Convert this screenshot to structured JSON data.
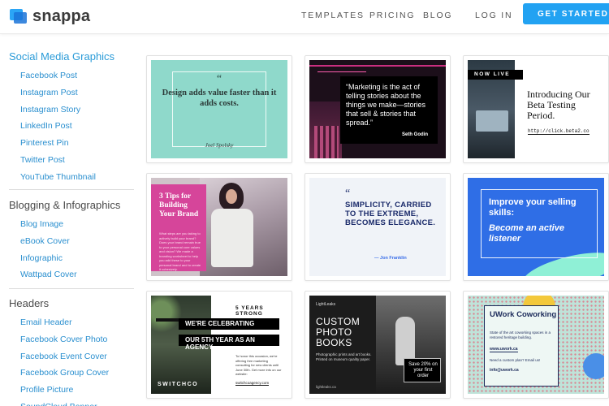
{
  "header": {
    "logo_text": "snappa",
    "nav": [
      "TEMPLATES",
      "PRICING",
      "BLOG"
    ],
    "login": "LOG IN",
    "cta": "GET STARTED FREE"
  },
  "sidebar": {
    "sections": [
      {
        "title": "Social Media Graphics",
        "items": [
          "Facebook Post",
          "Instagram Post",
          "Instagram Story",
          "LinkedIn Post",
          "Pinterest Pin",
          "Twitter Post",
          "YouTube Thumbnail"
        ]
      },
      {
        "title": "Blogging & Infographics",
        "items": [
          "Blog Image",
          "eBook Cover",
          "Infographic",
          "Wattpad Cover"
        ]
      },
      {
        "title": "Headers",
        "items": [
          "Email Header",
          "Facebook Cover Photo",
          "Facebook Event Cover",
          "Facebook Group Cover",
          "Profile Picture",
          "SoundCloud Banner"
        ]
      }
    ]
  },
  "templates": [
    {
      "quote_mark": "“",
      "text": "Design adds value faster than it adds costs.",
      "author": "Joel Spolsky"
    },
    {
      "text": "“Marketing is the act of telling stories about the things we make—stories that sell & stories that spread.”",
      "author": "Seth Godin"
    },
    {
      "badge": "NOW LIVE",
      "text": "Introducing Our Beta Testing Period.",
      "link": "http://click.beta2.co"
    },
    {
      "heading": "3 Tips for Building Your Brand",
      "body": "What steps are you taking to actively build your brand? Does your brand remain true to your personal core values and vision? We made a branding worksheet to help you add these to your personal brand and to create it cohesively."
    },
    {
      "quote_mark": "“",
      "text": "SIMPLICITY, CARRIED TO THE EXTREME, BECOMES ELEGANCE.",
      "author": "— Jon Franklin"
    },
    {
      "text": "Improve your selling skills:",
      "emphasis": "Become an active listener"
    },
    {
      "top": "5 YEARS STRONG",
      "line1": "WE'RE CELEBRATING",
      "line2": "OUR 5TH YEAR AS AN AGENCY",
      "body": "To honor this occasion, we're offering free marketing consulting for new clients until June 30th. Get more info on our website:",
      "brand": "SWITCHCO",
      "url": "switchcoagency.com"
    },
    {
      "small": "LightLeaks",
      "heading": "CUSTOM PHOTO BOOKS",
      "sub": "Photographic prints and art books. Printed on museum quality paper.",
      "badge": "Save 20% on your first order",
      "foot": "lightleaks.ca"
    },
    {
      "heading": "UWork Coworking",
      "body": "State of the art coworking spaces in a restored heritage building.",
      "url": "www.uwork.ca",
      "note": "Need a custom plan? Email us!",
      "email": "info@uwork.ca"
    }
  ]
}
